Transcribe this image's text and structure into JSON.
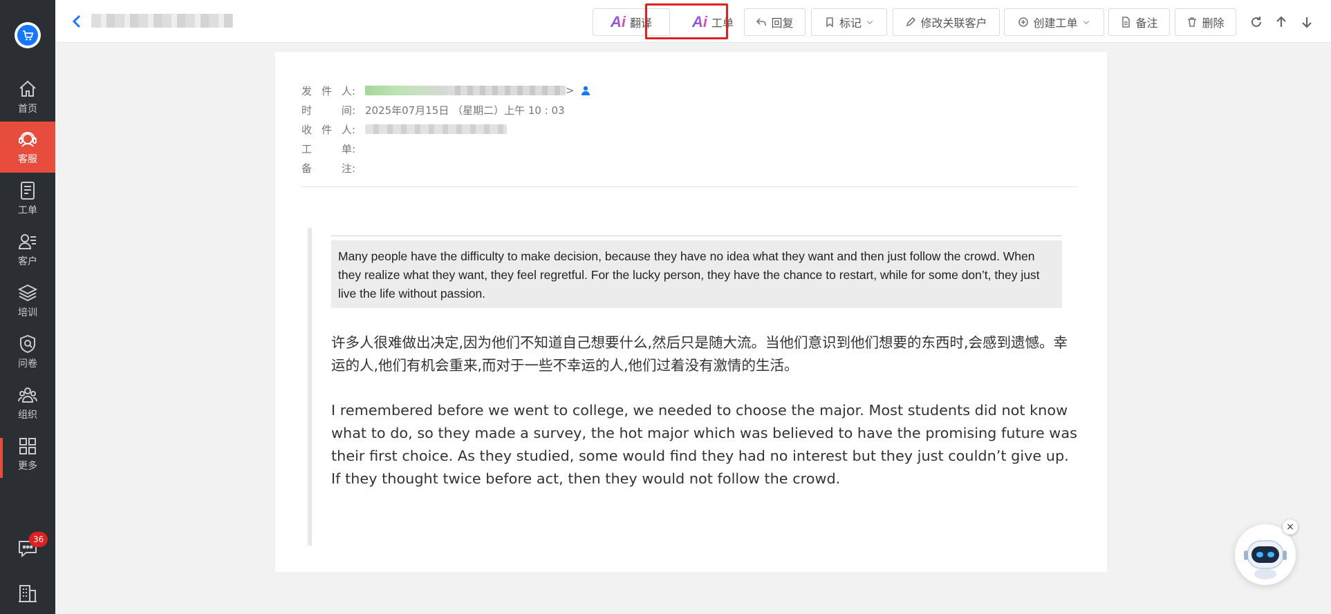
{
  "sidebar": {
    "items": [
      {
        "label": "首页",
        "icon": "home-icon"
      },
      {
        "label": "客服",
        "icon": "headset-icon",
        "active": true
      },
      {
        "label": "工单",
        "icon": "ticket-icon"
      },
      {
        "label": "客户",
        "icon": "customer-icon"
      },
      {
        "label": "培训",
        "icon": "layers-icon"
      },
      {
        "label": "问卷",
        "icon": "survey-icon"
      },
      {
        "label": "组织",
        "icon": "team-icon"
      },
      {
        "label": "更多",
        "icon": "grid-icon"
      }
    ],
    "chat_badge": "36",
    "active_color": "#e74c3c"
  },
  "toolbar": {
    "translate": "翻译",
    "ticket": "工单",
    "reply": "回复",
    "mark": "标记",
    "edit_customer": "修改关联客户",
    "create_ticket": "创建工单",
    "note": "备注",
    "delete": "删除",
    "ai_mark": "Ai"
  },
  "mail": {
    "labels": {
      "sender": [
        "发",
        "件",
        "人"
      ],
      "time": [
        "时",
        "",
        "间"
      ],
      "recipient": [
        "收",
        "件",
        "人"
      ],
      "ticket": [
        "工",
        "",
        "单"
      ],
      "note": [
        "备",
        "",
        "注"
      ]
    },
    "colon": ":",
    "time_value": "2025年07月15日 （星期二）上午 10 : 03",
    "sender_suffix": ">",
    "original_text": "Many people have the difficulty to make decision, because they have no idea what they want and then just follow the crowd. When they realize what they want, they feel regretful. For the lucky person, they have the chance to restart, while for some don’t, they just live the life without passion.",
    "translated_text": "许多人很难做出决定,因为他们不知道自己想要什么,然后只是随大流。当他们意识到他们想要的东西时,会感到遗憾。幸运的人,他们有机会重来,而对于一些不幸运的人,他们过着没有激情的生活。",
    "body_text": "I remembered before we went to college, we needed to choose the major. Most students did not know what to do, so they made a survey, the hot major which was believed to have the promising future was their first choice. As they studied, some would find they had no interest but they just couldn’t give up. If they thought twice before act, then they would not follow the crowd."
  },
  "bot": {
    "close": "×"
  }
}
